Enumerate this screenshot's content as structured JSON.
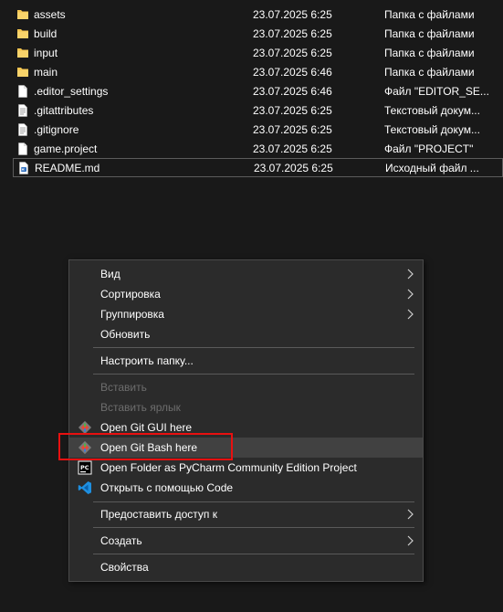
{
  "files": [
    {
      "name": "assets",
      "date": "23.07.2025 6:25",
      "type": "Папка с файлами",
      "icon": "folder-icon"
    },
    {
      "name": "build",
      "date": "23.07.2025 6:25",
      "type": "Папка с файлами",
      "icon": "folder-icon"
    },
    {
      "name": "input",
      "date": "23.07.2025 6:25",
      "type": "Папка с файлами",
      "icon": "folder-icon"
    },
    {
      "name": "main",
      "date": "23.07.2025 6:46",
      "type": "Папка с файлами",
      "icon": "folder-icon"
    },
    {
      "name": ".editor_settings",
      "date": "23.07.2025 6:46",
      "type": "Файл \"EDITOR_SE...",
      "icon": "file-icon"
    },
    {
      "name": ".gitattributes",
      "date": "23.07.2025 6:25",
      "type": "Текстовый докум...",
      "icon": "text-file-icon"
    },
    {
      "name": ".gitignore",
      "date": "23.07.2025 6:25",
      "type": "Текстовый докум...",
      "icon": "text-file-icon"
    },
    {
      "name": "game.project",
      "date": "23.07.2025 6:25",
      "type": "Файл \"PROJECT\"",
      "icon": "file-icon"
    },
    {
      "name": "README.md",
      "date": "23.07.2025 6:25",
      "type": "Исходный файл ...",
      "icon": "markdown-file-icon"
    }
  ],
  "menu": {
    "view": "Вид",
    "sort": "Сортировка",
    "group": "Группировка",
    "refresh": "Обновить",
    "customize": "Настроить папку...",
    "paste": "Вставить",
    "paste_shortcut": "Вставить ярлык",
    "git_gui": "Open Git GUI here",
    "git_bash": "Open Git Bash here",
    "pycharm": "Open Folder as PyCharm Community Edition Project",
    "vscode": "Открыть с помощью Code",
    "share": "Предоставить доступ к",
    "create": "Создать",
    "properties": "Свойства"
  },
  "colors": {
    "background": "#191919",
    "menu_bg": "#2b2b2b",
    "hover_bg": "#414141",
    "highlight": "#e81010",
    "folder": "#f3c44f",
    "vscode": "#1e8fe0"
  }
}
